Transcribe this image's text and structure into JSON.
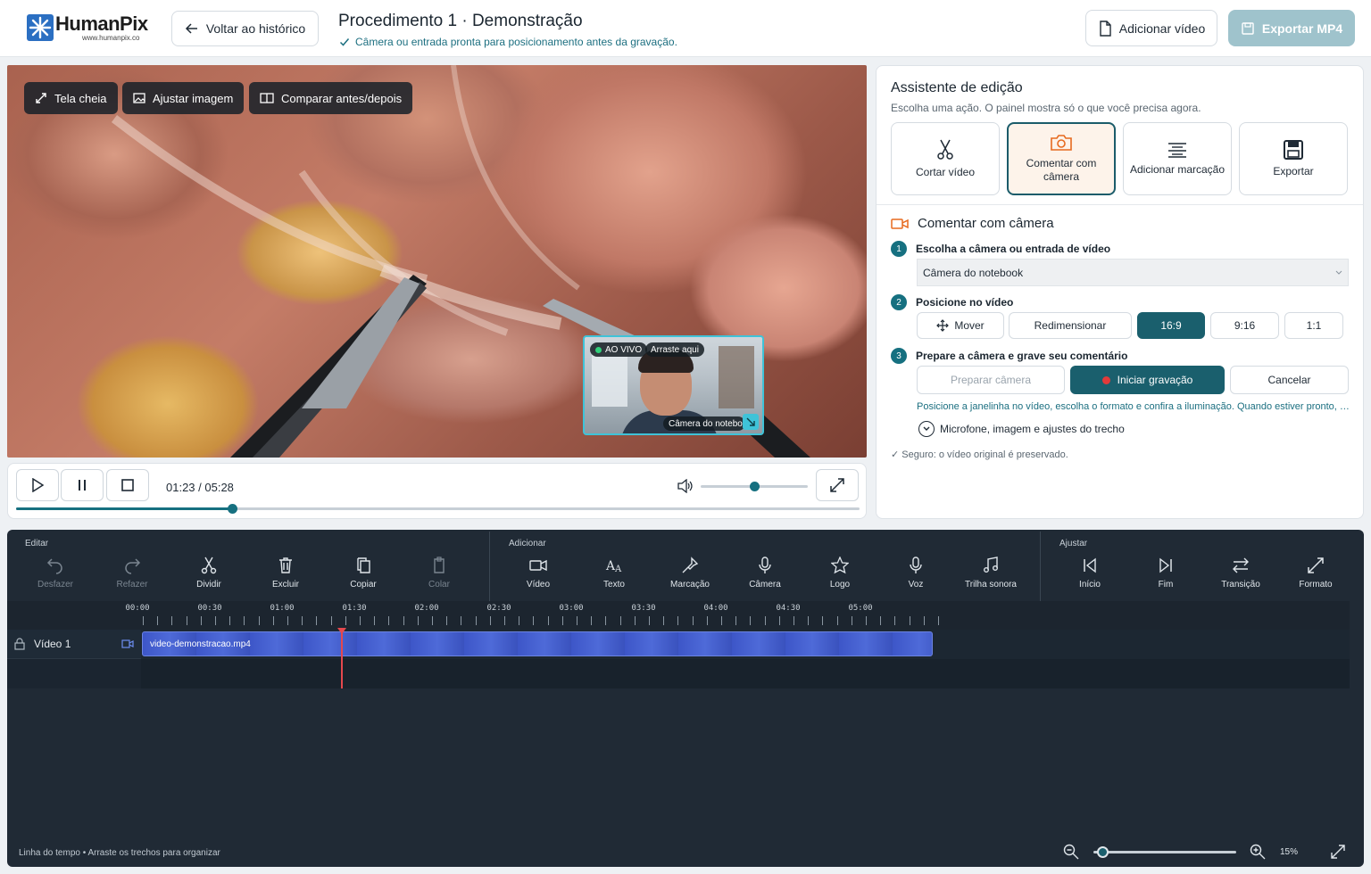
{
  "header": {
    "logo_name": "HumanPix",
    "logo_sub": "www.humanpix.co",
    "back_label": "Voltar ao histórico",
    "title": "Procedimento 1 · Demonstração",
    "subtitle": "Câmera ou entrada pronta para posicionamento antes da gravação.",
    "add_video_label": "Adicionar vídeo",
    "export_label": "Exportar MP4"
  },
  "video": {
    "fullscreen_label": "Tela cheia",
    "adjust_label": "Ajustar imagem",
    "compare_label": "Comparar antes/depois",
    "pip_live": "AO VIVO",
    "pip_drag": "Arraste aqui",
    "pip_source": "Câmera do notebook"
  },
  "player": {
    "time": "01:23 / 05:28",
    "volume_fraction": 0.5,
    "progress_fraction": 0.26
  },
  "assistant": {
    "title": "Assistente de edição",
    "hint": "Escolha uma ação. O painel mostra só o que você precisa agora.",
    "cards": [
      "Cortar vídeo",
      "Comentar com câmera",
      "Adicionar marcação",
      "Exportar"
    ],
    "section_title": "Comentar com câmera",
    "step1": "Escolha a câmera ou entrada de vídeo",
    "camera_select": "Câmera do notebook",
    "step2": "Posicione no vídeo",
    "position_options": [
      "Mover",
      "Redimensionar",
      "16:9",
      "9:16",
      "1:1"
    ],
    "step3": "Prepare a câmera e grave seu comentário",
    "prepare_label": "Preparar câmera",
    "record_label": "Iniciar gravação",
    "cancel_label": "Cancelar",
    "note": "Posicione a janelinha no vídeo, escolha o formato e confira a iluminação. Quando estiver pronto, c...",
    "expander": "Microfone, imagem e ajustes do trecho",
    "safe": "✓  Seguro: o vídeo original é preservado."
  },
  "timeline": {
    "groups": [
      "Editar",
      "Adicionar",
      "Ajustar"
    ],
    "edit_tools": [
      "Desfazer",
      "Refazer",
      "Dividir",
      "Excluir",
      "Copiar",
      "Colar"
    ],
    "add_tools": [
      "Vídeo",
      "Texto",
      "Marcação",
      "Câmera",
      "Logo",
      "Voz",
      "Trilha sonora"
    ],
    "adjust_tools": [
      "Início",
      "Fim",
      "Transição",
      "Formato"
    ],
    "ruler": [
      "00:00",
      "00:30",
      "01:00",
      "01:30",
      "02:00",
      "02:30",
      "03:00",
      "03:30",
      "04:00",
      "04:30",
      "05:00"
    ],
    "track_name": "Vídeo 1",
    "clip_name": "video-demonstracao.mp4",
    "footer": "Linha do tempo  •  Arraste os trechos para organizar",
    "zoom": "15%"
  },
  "colors": {
    "accent": "#167080",
    "accent_dark": "#1a5f6d",
    "record": "#e23a3a",
    "clip": "#4e6ad8"
  }
}
